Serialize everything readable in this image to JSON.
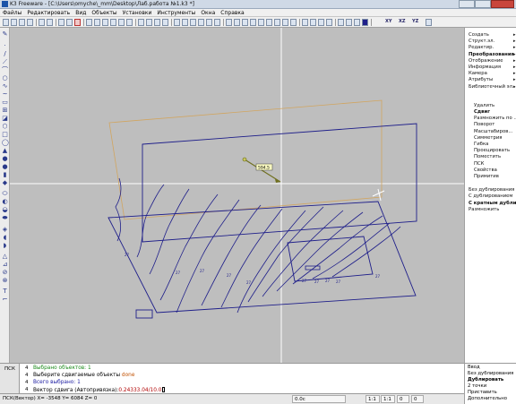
{
  "window": {
    "title": "K3 Freeware - [C:\\Users\\omyche\\_mm\\Desktop\\Лаб.работа №1.k3 *]"
  },
  "menu": [
    "Файлы",
    "Редактировать",
    "Вид",
    "Объекты",
    "Установки",
    "Инструменты",
    "Окна",
    "Справка"
  ],
  "toolbar": {
    "labels": [
      "XY",
      "XZ",
      "YZ"
    ]
  },
  "canvas": {
    "dimension_label": "594.5"
  },
  "panel": {
    "items": [
      {
        "label": "Создать",
        "arrow": true,
        "bold": false
      },
      {
        "label": "Структ.эл.",
        "arrow": true,
        "bold": false
      },
      {
        "label": "Редактир.",
        "arrow": true,
        "bold": false
      },
      {
        "label": "Преобразования",
        "arrow": true,
        "bold": true
      },
      {
        "label": "Отображение",
        "arrow": true,
        "bold": false
      },
      {
        "label": "Информация",
        "arrow": true,
        "bold": false
      },
      {
        "label": "Камера",
        "arrow": true,
        "bold": false
      },
      {
        "label": "Атрибуты",
        "arrow": true,
        "bold": false
      },
      {
        "label": "Библиотечный эл...",
        "arrow": true,
        "bold": false
      }
    ],
    "sub_items": [
      {
        "label": "Удалить",
        "arrow": false,
        "bold": false
      },
      {
        "label": "Сдвиг",
        "arrow": true,
        "bold": true
      },
      {
        "label": "Размножить по ...",
        "arrow": false,
        "bold": false
      },
      {
        "label": "Поворот",
        "arrow": true,
        "bold": false
      },
      {
        "label": "Масштабиров...",
        "arrow": true,
        "bold": false
      },
      {
        "label": "Симметрия",
        "arrow": true,
        "bold": false
      },
      {
        "label": "Гибка",
        "arrow": false,
        "bold": false
      },
      {
        "label": "Проецировать",
        "arrow": false,
        "bold": false
      },
      {
        "label": "Поместить",
        "arrow": false,
        "bold": false
      },
      {
        "label": "ПСК",
        "arrow": false,
        "bold": false
      },
      {
        "label": "Свойства",
        "arrow": true,
        "bold": false
      },
      {
        "label": "Примитив",
        "arrow": false,
        "bold": false
      }
    ],
    "options": [
      {
        "label": "Без дублирования",
        "bold": false
      },
      {
        "label": "С дублированием",
        "bold": false
      },
      {
        "label": "С кратным дублир...",
        "bold": true
      },
      {
        "label": "Размножить",
        "bold": false
      }
    ]
  },
  "command": {
    "psk_label": "ПСК",
    "line_numbers": [
      "4",
      "4",
      "4",
      "4"
    ],
    "line1": "Выбрано объектов: 1",
    "line2_prefix": "Выберите сдвигаемые объекты",
    "line2_done": "done",
    "line3": "Всего выбрано: 1",
    "line4_prefix": "Вектор сдвига (Автопривязка):",
    "line4_value": "0.24333.04/10.0"
  },
  "right_cmd": [
    "Ввод",
    "Без дублирования",
    "Дублировать",
    "2 точки",
    "Приставить",
    "Дополнительно"
  ],
  "status": {
    "coords": "ПСК(Вектор) X= -3548    Y= 6084    Z= 0",
    "angle": "0.0c",
    "scale1": "1:1",
    "scale2": "1:1",
    "val1": "0",
    "val2": "0"
  },
  "colors": {
    "drawing": "#1f1f8a",
    "frame": "#d1a560",
    "crosshair": "#ffffff",
    "canvas": "#bebebe"
  }
}
